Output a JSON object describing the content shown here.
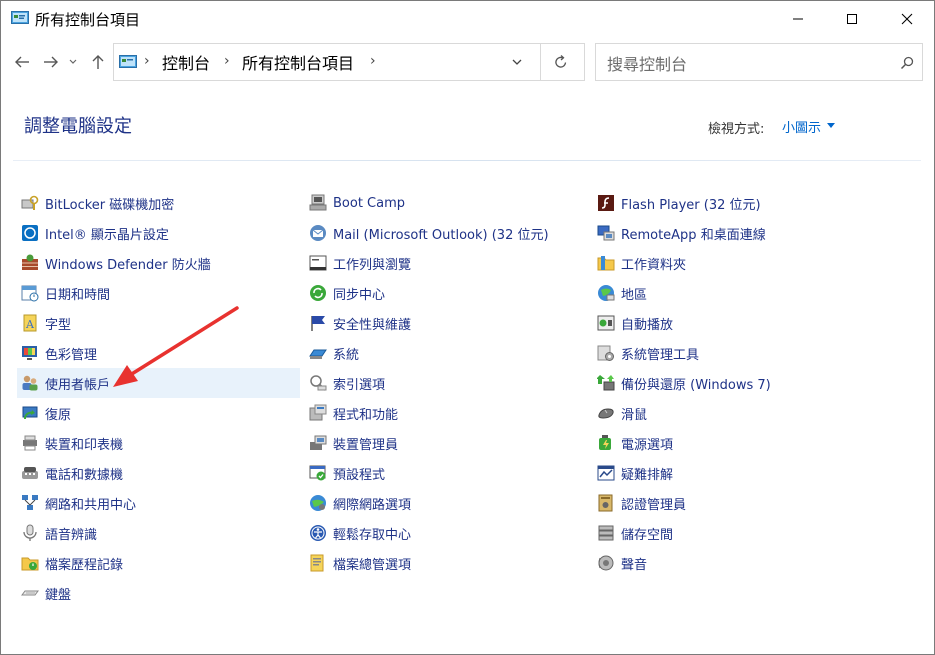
{
  "window": {
    "title": "所有控制台項目"
  },
  "nav": {
    "breadcrumb": [
      "控制台",
      "所有控制台項目"
    ],
    "search_placeholder": "搜尋控制台"
  },
  "header": {
    "title": "調整電腦設定",
    "view_by_label": "檢視方式:",
    "view_by_value": "小圖示"
  },
  "columns": [
    [
      {
        "label": "BitLocker 磁碟機加密",
        "icon": "bitlocker-icon"
      },
      {
        "label": "Intel® 顯示晶片設定",
        "icon": "intel-graphics-icon"
      },
      {
        "label": "Windows Defender 防火牆",
        "icon": "firewall-icon"
      },
      {
        "label": "日期和時間",
        "icon": "date-time-icon"
      },
      {
        "label": "字型",
        "icon": "fonts-icon"
      },
      {
        "label": "色彩管理",
        "icon": "color-management-icon"
      },
      {
        "label": "使用者帳戶",
        "icon": "user-accounts-icon"
      },
      {
        "label": "復原",
        "icon": "recovery-icon"
      },
      {
        "label": "裝置和印表機",
        "icon": "devices-printers-icon"
      },
      {
        "label": "電話和數據機",
        "icon": "phone-modem-icon"
      },
      {
        "label": "網路和共用中心",
        "icon": "network-sharing-icon"
      },
      {
        "label": "語音辨識",
        "icon": "speech-recognition-icon"
      },
      {
        "label": "檔案歷程記錄",
        "icon": "file-history-icon"
      },
      {
        "label": "鍵盤",
        "icon": "keyboard-icon"
      }
    ],
    [
      {
        "label": "Boot Camp",
        "icon": "boot-camp-icon"
      },
      {
        "label": "Mail (Microsoft Outlook) (32 位元)",
        "icon": "mail-icon"
      },
      {
        "label": "工作列與瀏覽",
        "icon": "taskbar-icon"
      },
      {
        "label": "同步中心",
        "icon": "sync-center-icon"
      },
      {
        "label": "安全性與維護",
        "icon": "security-maintenance-icon"
      },
      {
        "label": "系統",
        "icon": "system-icon"
      },
      {
        "label": "索引選項",
        "icon": "indexing-options-icon"
      },
      {
        "label": "程式和功能",
        "icon": "programs-features-icon"
      },
      {
        "label": "裝置管理員",
        "icon": "device-manager-icon"
      },
      {
        "label": "預設程式",
        "icon": "default-programs-icon"
      },
      {
        "label": "網際網路選項",
        "icon": "internet-options-icon"
      },
      {
        "label": "輕鬆存取中心",
        "icon": "ease-of-access-icon"
      },
      {
        "label": "檔案總管選項",
        "icon": "file-explorer-options-icon"
      }
    ],
    [
      {
        "label": "Flash Player (32 位元)",
        "icon": "flash-player-icon"
      },
      {
        "label": "RemoteApp 和桌面連線",
        "icon": "remoteapp-icon"
      },
      {
        "label": "工作資料夾",
        "icon": "work-folders-icon"
      },
      {
        "label": "地區",
        "icon": "region-icon"
      },
      {
        "label": "自動播放",
        "icon": "autoplay-icon"
      },
      {
        "label": "系統管理工具",
        "icon": "admin-tools-icon"
      },
      {
        "label": "備份與還原 (Windows 7)",
        "icon": "backup-restore-icon"
      },
      {
        "label": "滑鼠",
        "icon": "mouse-icon"
      },
      {
        "label": "電源選項",
        "icon": "power-options-icon"
      },
      {
        "label": "疑難排解",
        "icon": "troubleshooting-icon"
      },
      {
        "label": "認證管理員",
        "icon": "credential-manager-icon"
      },
      {
        "label": "儲存空間",
        "icon": "storage-spaces-icon"
      },
      {
        "label": "聲音",
        "icon": "sound-icon"
      }
    ]
  ],
  "highlighted_item": "使用者帳戶",
  "colors": {
    "link": "#1e3287",
    "accent": "#0066cc",
    "highlight": "#e8f2fb",
    "arrow": "#e8322f"
  }
}
